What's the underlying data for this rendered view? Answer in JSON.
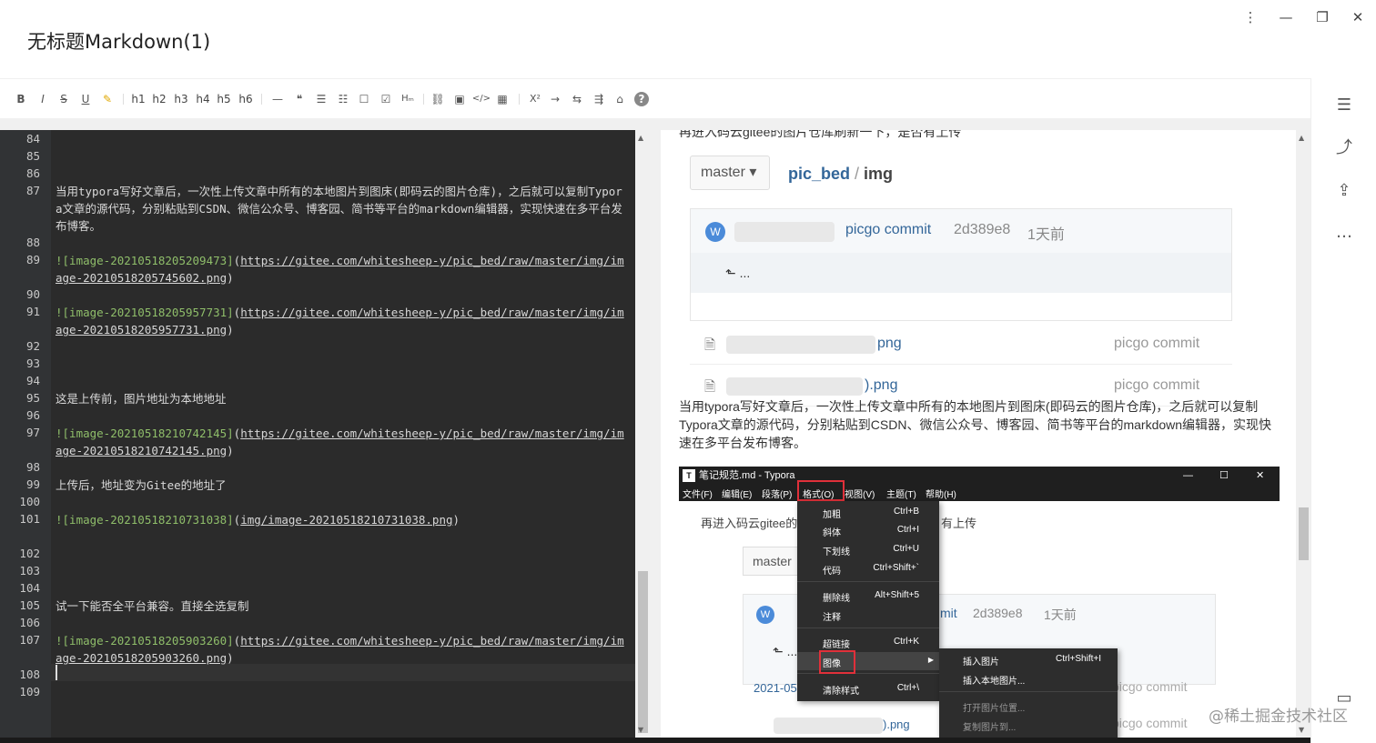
{
  "window": {
    "title": "无标题Markdown(1)",
    "controls": {
      "menu": "⋮",
      "minimize": "—",
      "restore": "❐",
      "close": "✕"
    }
  },
  "toolbar": {
    "bold": "B",
    "italic": "I",
    "strike": "S",
    "underline": "U",
    "highlight": "✎",
    "h1": "h1",
    "h2": "h2",
    "h3": "h3",
    "h4": "h4",
    "h5": "h5",
    "h6": "h6",
    "hr": "—",
    "quote": "❝",
    "ul": "☰",
    "ol": "☷",
    "check": "☐",
    "checked": "☑",
    "html": "Hₘ",
    "link": "⛓",
    "image": "▣",
    "code": "</>",
    "table": "▦",
    "sup": "X²",
    "arrow1": "→",
    "arrow2": "⇆",
    "arrow3": "⇶",
    "shirt": "⌂",
    "help": "?"
  },
  "right_rail": {
    "toc": "☰",
    "share": "⤴",
    "export": "⇪",
    "more": "…",
    "preview": "▭"
  },
  "editor": {
    "lines": [
      {
        "n": "84",
        "text": ""
      },
      {
        "n": "85",
        "text": ""
      },
      {
        "n": "86",
        "text": ""
      },
      {
        "n": "87",
        "text": "当用typora写好文章后，一次性上传文章中所有的本地图片到图床(即码云的图片仓库)，之后就可以复制Typora文章的源代码，分别粘贴到CSDN、微信公众号、博客园、简书等平台的markdown编辑器，实现快速在多平台发布博客。"
      },
      {
        "n": "88",
        "text": ""
      },
      {
        "n": "89",
        "alt": "![image-20210518205209473]",
        "url": "https://gitee.com/whitesheep-y/pic_bed/raw/master/img/image-20210518205745602.png"
      },
      {
        "n": "90",
        "text": ""
      },
      {
        "n": "91",
        "alt": "![image-20210518205957731]",
        "url": "https://gitee.com/whitesheep-y/pic_bed/raw/master/img/image-20210518205957731.png"
      },
      {
        "n": "92",
        "text": ""
      },
      {
        "n": "93",
        "text": ""
      },
      {
        "n": "94",
        "text": ""
      },
      {
        "n": "95",
        "text": "这是上传前，图片地址为本地地址"
      },
      {
        "n": "96",
        "text": ""
      },
      {
        "n": "97",
        "alt": "![image-20210518210742145]",
        "url": "https://gitee.com/whitesheep-y/pic_bed/raw/master/img/image-20210518210742145.png"
      },
      {
        "n": "98",
        "text": ""
      },
      {
        "n": "99",
        "text": "上传后，地址变为Gitee的地址了"
      },
      {
        "n": "100",
        "text": ""
      },
      {
        "n": "101",
        "alt": "![image-20210518210731038]",
        "url": "img/image-20210518210731038.png"
      },
      {
        "n": "102",
        "text": ""
      },
      {
        "n": "103",
        "text": ""
      },
      {
        "n": "104",
        "text": ""
      },
      {
        "n": "105",
        "text": "试一下能否全平台兼容。直接全选复制"
      },
      {
        "n": "106",
        "text": ""
      },
      {
        "n": "107",
        "alt": "![image-20210518205903260]",
        "url": "https://gitee.com/whitesheep-y/pic_bed/raw/master/img/image-20210518205903260.png"
      },
      {
        "n": "108",
        "text": ""
      },
      {
        "n": "109",
        "text": ""
      }
    ]
  },
  "preview": {
    "cut_text": "再进入码云gitee的图片仓库刷新一下，是否有上传",
    "repo": {
      "branch": "master ▾",
      "path_repo": "pic_bed",
      "path_sep": " / ",
      "path_folder": "img",
      "avatar": "W",
      "commit_msg": "picgo commit",
      "commit_hash": "2d389e8",
      "commit_time": "1天前",
      "back": "⬑ ...",
      "files": [
        {
          "name": "png",
          "msg": "picgo commit",
          "icon": "🗎"
        },
        {
          "name": ").png",
          "msg": "picgo commit",
          "icon": "🗎"
        }
      ]
    },
    "paragraph": "当用typora写好文章后，一次性上传文章中所有的本地图片到图床(即码云的图片仓库)，之后就可以复制Typora文章的源代码，分别粘贴到CSDN、微信公众号、博客园、简书等平台的markdown编辑器，实现快速在多平台发布博客。",
    "shot": {
      "title": "笔记规范.md - Typora",
      "title_icon": "T",
      "wc_min": "—",
      "wc_max": "☐",
      "wc_close": "✕",
      "menus": [
        "文件(F)",
        "编辑(E)",
        "段落(P)",
        "格式(O)",
        "视图(V)",
        "主题(T)",
        "帮助(H)"
      ],
      "body_text": "再进入码云gitee的图片仓库刷新一下，是否有上传",
      "body_text_right": "有上传",
      "master": "master",
      "avatar": "W",
      "commit_msg": "mit",
      "commit_hash": "2d389e8",
      "commit_time": "1天前",
      "back": "⬑ ...",
      "file1": "2021-05-",
      "file1_msg": "picgo commit",
      "file2": ").png",
      "file2_msg": "picgo commit",
      "format_menu": [
        {
          "label": "加粗",
          "key": "Ctrl+B"
        },
        {
          "label": "斜体",
          "key": "Ctrl+I"
        },
        {
          "label": "下划线",
          "key": "Ctrl+U"
        },
        {
          "label": "代码",
          "key": "Ctrl+Shift+`"
        },
        {
          "label": "删除线",
          "key": "Alt+Shift+5"
        },
        {
          "label": "注释",
          "key": ""
        },
        {
          "label": "超链接",
          "key": "Ctrl+K"
        },
        {
          "label": "图像",
          "key": ""
        },
        {
          "label": "清除样式",
          "key": "Ctrl+\\"
        }
      ],
      "submenu": [
        {
          "label": "插入图片",
          "key": "Ctrl+Shift+I"
        },
        {
          "label": "插入本地图片...",
          "key": ""
        },
        {
          "label": "打开图片位置...",
          "key": ""
        },
        {
          "label": "复制图片到...",
          "key": ""
        }
      ]
    }
  },
  "watermark": "@稀土掘金技术社区"
}
